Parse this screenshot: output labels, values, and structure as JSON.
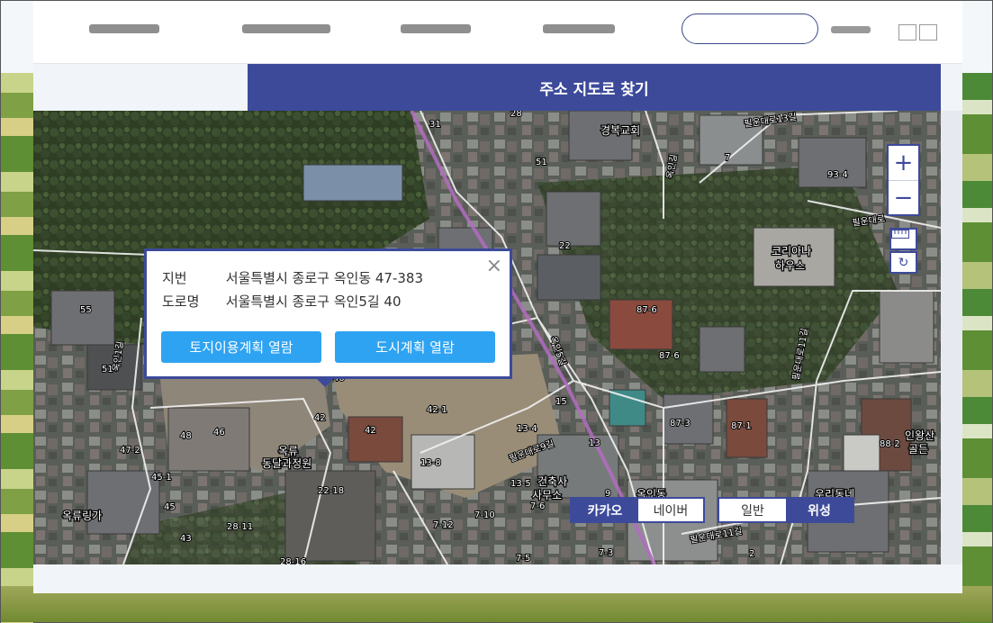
{
  "window": {
    "accent_color": "#3d4a9a",
    "button_color": "#2ea3f2"
  },
  "panel": {
    "title": "주소 지도로 찾기"
  },
  "popup": {
    "rows": [
      {
        "key": "지번",
        "value": "서울특별시 종로구 옥인동 47-383"
      },
      {
        "key": "도로명",
        "value": "서울특별시 종로구 옥인5길 40"
      }
    ],
    "close_icon": "×",
    "buttons": [
      "토지이용계획 열람",
      "도시계획 열람"
    ]
  },
  "map_controls": {
    "zoom_in": "+",
    "zoom_out": "−",
    "ruler_icon": "ruler-icon",
    "reset_icon": "↻"
  },
  "provider_toggle": {
    "options": [
      "카카오",
      "네이버"
    ],
    "selected": "카카오"
  },
  "maptype_toggle": {
    "options": [
      "일반",
      "위성"
    ],
    "selected": "위성"
  },
  "map_labels": {
    "places": [
      "경복교회",
      "코리아나\n하우스",
      "옥류\n동달과정원",
      "옥류링가",
      "건축사\n사무소",
      "인왕산\n골든",
      "우리동네",
      "옥인동"
    ],
    "roads": [
      "필운대로13길",
      "필운대로",
      "옥인1길",
      "옥인5길",
      "필운대로11길",
      "필운대로9길",
      "필운대로",
      "옥인길"
    ],
    "lots": [
      "31",
      "28",
      "51",
      "22",
      "7",
      "93-4",
      "55",
      "51",
      "40",
      "42",
      "42-1",
      "42",
      "46",
      "48",
      "47-2",
      "45-1",
      "45",
      "43",
      "28-11",
      "28-16",
      "22-18",
      "13-8",
      "13-4",
      "13",
      "13-5",
      "7-6",
      "7-12",
      "7-10",
      "7-5",
      "7-3",
      "9",
      "15",
      "87-6",
      "87-6",
      "87-3",
      "87-1",
      "88-2",
      "2"
    ]
  }
}
